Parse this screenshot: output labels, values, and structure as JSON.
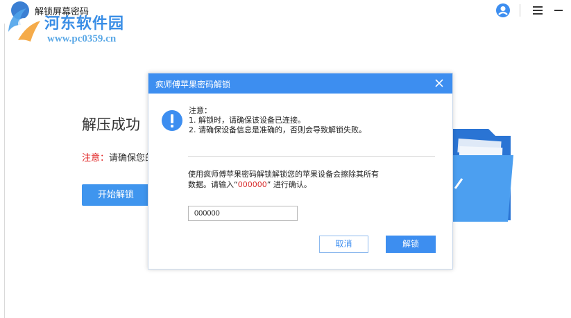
{
  "window": {
    "title": "解锁屏幕密码"
  },
  "watermark": {
    "title": "河东软件园",
    "url": "www.pc0359.cn"
  },
  "main": {
    "heading": "解压成功",
    "note_label": "注意：",
    "note_text": "请确保您的",
    "start_button": "开始解锁"
  },
  "dialog": {
    "title": "疯师傅苹果密码解锁",
    "notice_title": "注意：",
    "notice_lines": [
      "1. 解锁时，请确保该设备已连接。",
      "2. 请确保设备信息是准确的，否则会导致解锁失败。"
    ],
    "message_line1": "使用疯师傅苹果密码解锁解锁您的苹果设备会擦除其所有",
    "message_prefix": "数据。请输入“",
    "message_code": "000000",
    "message_suffix": "” 进行确认。",
    "input_value": "000000",
    "cancel_label": "取消",
    "unlock_label": "解锁"
  },
  "colors": {
    "accent": "#3d8ef0",
    "warning": "#e02020"
  }
}
